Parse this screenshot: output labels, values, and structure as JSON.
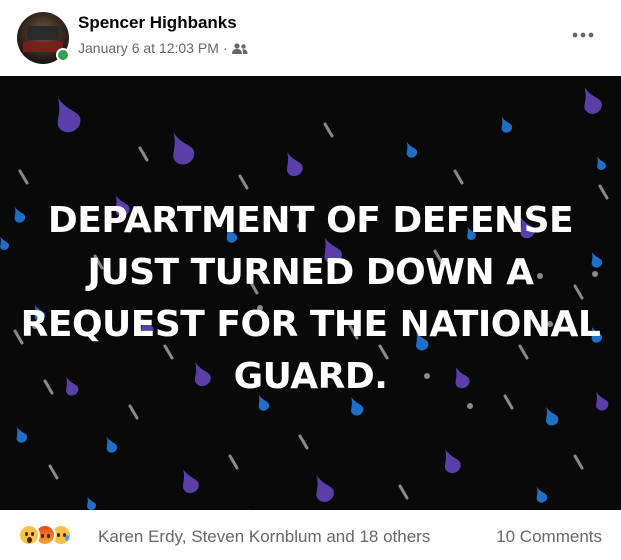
{
  "post": {
    "author": "Spencer Highbanks",
    "timestamp": "January 6 at 12:03 PM",
    "separator": "·",
    "audience_icon": "friends-icon",
    "more_icon": "more-horizontal-icon"
  },
  "image": {
    "headline_lines": [
      "DEPARTMENT OF DEFENSE",
      "JUST TURNED DOWN A",
      "REQUEST FOR THE NATIONAL",
      "GUARD."
    ],
    "background_color": "#090909",
    "drop_colors": [
      "#5a3fa8",
      "#1f6fc7",
      "#8a8a8a"
    ]
  },
  "engagement": {
    "reaction_icons": [
      "wow-reaction-icon",
      "angry-reaction-icon",
      "sad-reaction-icon"
    ],
    "reacted_by": "Karen Erdy, Steven Kornblum and 18 others",
    "comments": "10 Comments"
  }
}
